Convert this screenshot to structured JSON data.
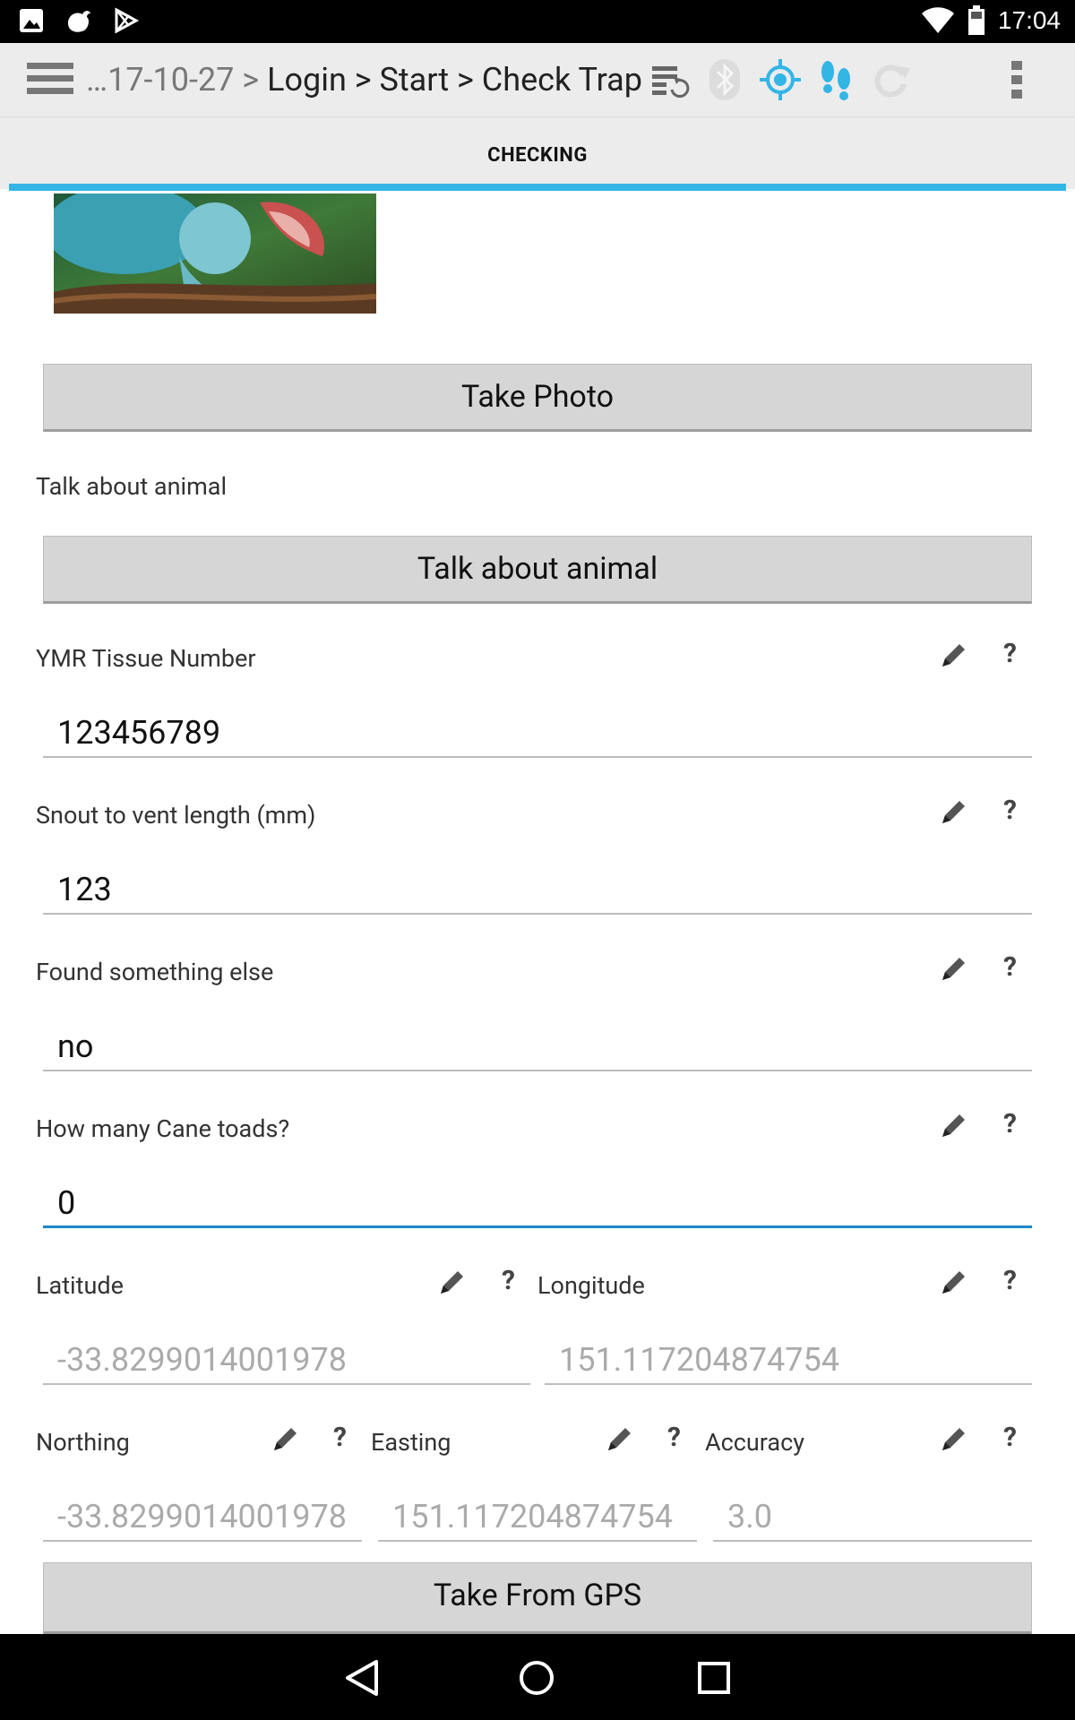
{
  "status_bar": {
    "time": "17:04",
    "left_icons": [
      "image-icon",
      "notification-blob-icon",
      "play-store-icon"
    ],
    "right_icons": [
      "wifi-icon",
      "battery-icon"
    ]
  },
  "action_bar": {
    "breadcrumb_prefix": "…17-10-27 >",
    "breadcrumb_path": "Login > Start > Check Trap",
    "icons": [
      "sync-settings-icon",
      "bluetooth-icon",
      "gps-target-icon",
      "footsteps-icon",
      "refresh-icon",
      "overflow-menu-icon"
    ],
    "accent_color": "#33b5e5"
  },
  "tab": {
    "title": "CHECKING"
  },
  "form": {
    "take_photo_label": "Take Photo",
    "talk_about_animal_caption": "Talk about animal",
    "talk_about_animal_button": "Talk about animal",
    "tissue": {
      "label": "YMR Tissue Number",
      "value": "123456789"
    },
    "snout": {
      "label": "Snout to vent length (mm)",
      "value": "123"
    },
    "found": {
      "label": "Found something else",
      "value": "no"
    },
    "cane_toads": {
      "label": "How many Cane toads?",
      "value": "0"
    },
    "latitude": {
      "label": "Latitude",
      "value": "-33.8299014001978"
    },
    "longitude": {
      "label": "Longitude",
      "value": "151.117204874754"
    },
    "northing": {
      "label": "Northing",
      "value": "-33.8299014001978"
    },
    "easting": {
      "label": "Easting",
      "value": "151.117204874754"
    },
    "accuracy": {
      "label": "Accuracy",
      "value": "3.0"
    },
    "help_glyph": "?",
    "take_from_gps_label": "Take From GPS"
  }
}
